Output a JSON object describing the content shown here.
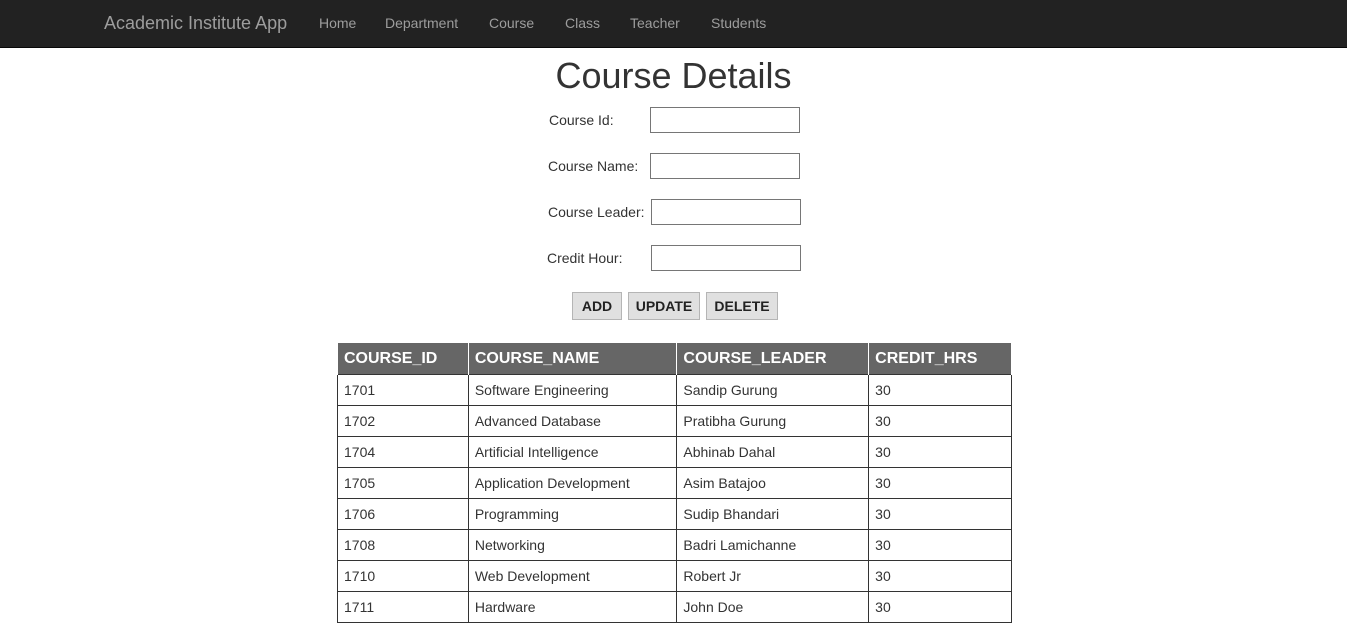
{
  "navbar": {
    "brand": "Academic Institute App",
    "links": [
      "Home",
      "Department",
      "Course",
      "Class",
      "Teacher",
      "Students"
    ]
  },
  "page": {
    "title": "Course Details"
  },
  "form": {
    "course_id_label": "Course Id:",
    "course_name_label": "Course Name:",
    "course_leader_label": "Course Leader:",
    "credit_hour_label": "Credit Hour:",
    "course_id_value": "",
    "course_name_value": "",
    "course_leader_value": "",
    "credit_hour_value": ""
  },
  "buttons": {
    "add": "ADD",
    "update": "UPDATE",
    "delete": "DELETE"
  },
  "table": {
    "headers": [
      "COURSE_ID",
      "COURSE_NAME",
      "COURSE_LEADER",
      "CREDIT_HRS"
    ],
    "rows": [
      [
        "1701",
        "Software Engineering",
        "Sandip Gurung",
        "30"
      ],
      [
        "1702",
        "Advanced Database",
        "Pratibha Gurung",
        "30"
      ],
      [
        "1704",
        "Artificial Intelligence",
        "Abhinab Dahal",
        "30"
      ],
      [
        "1705",
        "Application Development",
        "Asim Batajoo",
        "30"
      ],
      [
        "1706",
        "Programming",
        "Sudip Bhandari",
        "30"
      ],
      [
        "1708",
        "Networking",
        "Badri Lamichanne",
        "30"
      ],
      [
        "1710",
        "Web Development",
        "Robert Jr",
        "30"
      ],
      [
        "1711",
        "Hardware",
        "John Doe",
        "30"
      ]
    ]
  }
}
